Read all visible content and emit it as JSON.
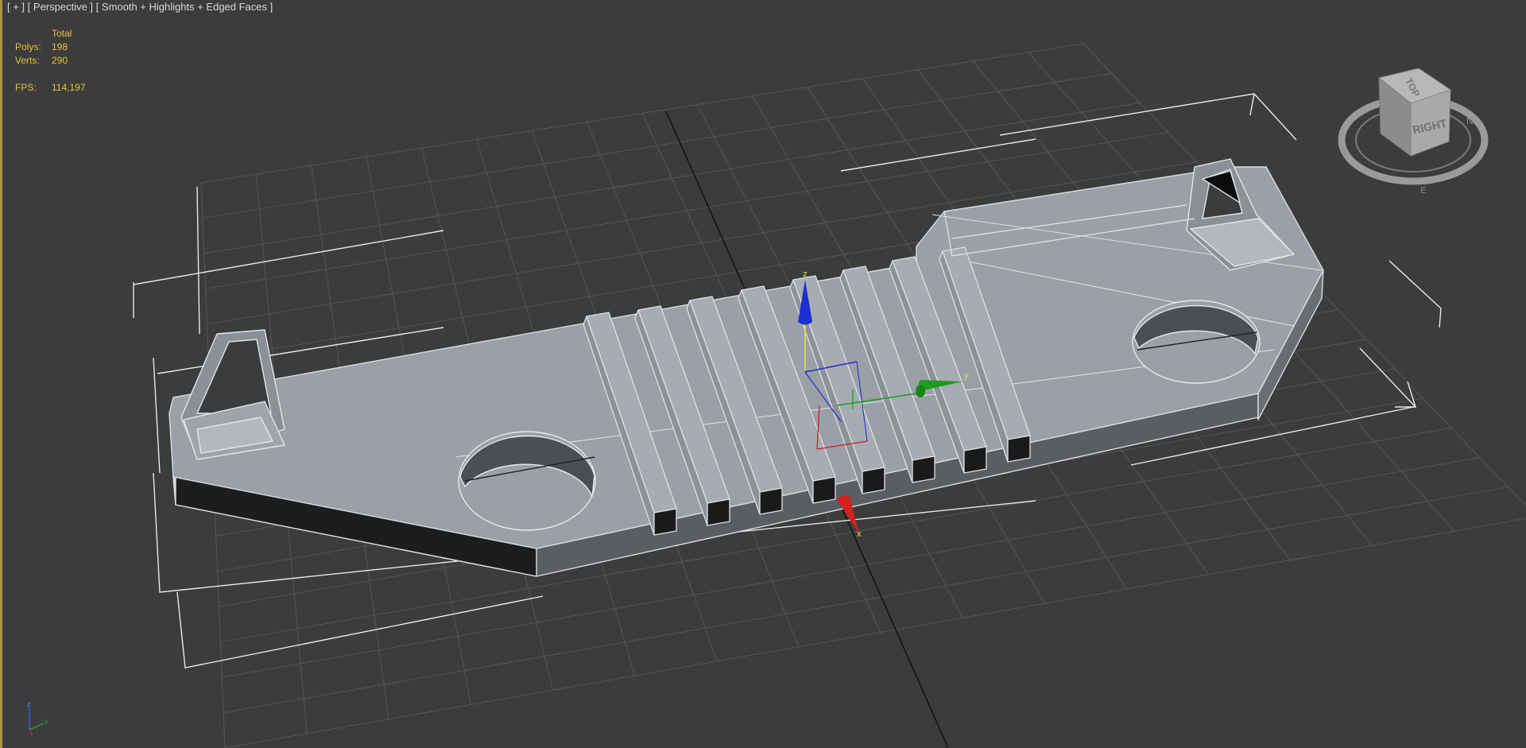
{
  "viewport_label": {
    "plus": "[ + ]",
    "view": "[ Perspective ]",
    "shading": "[ Smooth + Highlights + Edged Faces ]"
  },
  "stats": {
    "header": "Total",
    "polys_label": "Polys:",
    "polys_value": "198",
    "verts_label": "Verts:",
    "verts_value": "290",
    "fps_label": "FPS:",
    "fps_value": "114,197"
  },
  "viewcube": {
    "top": "TOP",
    "right": "RIGHT"
  },
  "gizmo": {
    "x": "x",
    "y": "y",
    "z": "z"
  },
  "colors": {
    "background": "#3c3c3c",
    "grid": "#555555",
    "model_top": "#9aa0a6",
    "model_side": "#5d6064",
    "axis_x": "#d42020",
    "axis_y": "#1e9a1e",
    "axis_z": "#1c2fd0",
    "stats_text": "#e7c23a",
    "active_border": "#b0923c"
  }
}
